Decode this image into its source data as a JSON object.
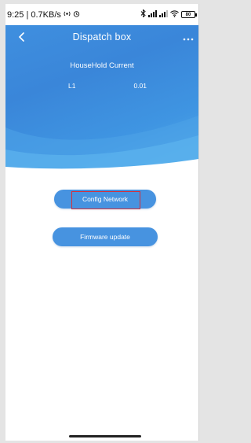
{
  "status_bar": {
    "time_speed": "9:25 | 0.7KB/s",
    "left_icons": [
      "hotspot-icon",
      "alarm-icon"
    ],
    "right_icons": [
      "bluetooth-icon",
      "signal-icon",
      "signal-icon",
      "wifi-icon"
    ],
    "battery": "80"
  },
  "nav": {
    "title": "Dispatch box",
    "back_icon": "chevron-left-icon",
    "more_icon": "more-dots-icon"
  },
  "household": {
    "title": "HouseHold Current",
    "phase_label": "L1",
    "phase_value": "0.01"
  },
  "buttons": {
    "config_network": "Config Network",
    "firmware_update": "Firmware update"
  },
  "colors": {
    "header_blue": "#3a86d9",
    "button_blue": "#4793e0",
    "highlight_red": "#d4303a"
  }
}
